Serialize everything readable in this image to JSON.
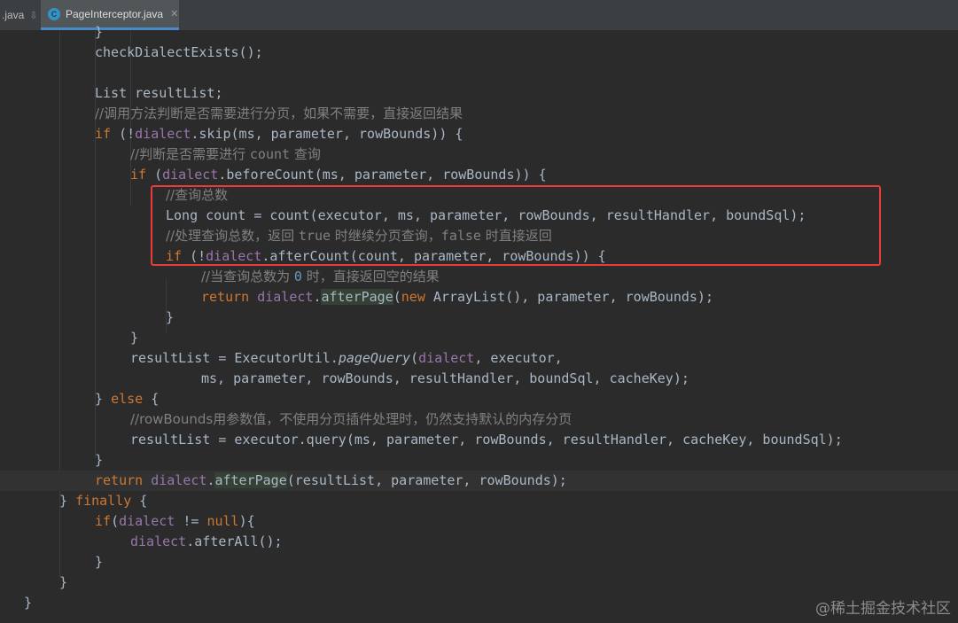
{
  "tabs": {
    "prev": {
      "label": ".java",
      "pin": "⇩"
    },
    "active": {
      "icon": "C",
      "label": "PageInterceptor.java",
      "close": "✕"
    }
  },
  "watermark": "@稀土掘金技术社区",
  "colors": {
    "background": "#2b2b2b",
    "keyword": "#cc7832",
    "field": "#9876aa",
    "comment": "#808080",
    "number": "#6897bb",
    "highlight_box": "#e83b3b"
  },
  "code": {
    "l1": "}",
    "l2": "checkDialectExists();",
    "l3": "List resultList;",
    "l4": "//调用方法判断是否需要进行分页，如果不需要，直接返回结果",
    "l5_if": "if",
    "l5_open": " (!",
    "l5_dialect": "dialect",
    "l5_rest": ".skip(ms, parameter, rowBounds)) {",
    "l6a": "//判断是否需要进行 ",
    "l6b": "count",
    "l6c": " 查询",
    "l7_if": "if",
    "l7_open": " (",
    "l7_dialect": "dialect",
    "l7_rest": ".beforeCount(ms, parameter, rowBounds)) {",
    "l8": "//查询总数",
    "l9": "Long count = count(executor, ms, parameter, rowBounds, resultHandler, boundSql);",
    "l10a": "//处理查询总数，返回 ",
    "l10b": "true",
    "l10c": " 时继续分页查询，",
    "l10d": "false",
    "l10e": " 时直接返回",
    "l11_if": "if",
    "l11_open": " (!",
    "l11_dialect": "dialect",
    "l11_rest": ".afterCount(count, parameter, rowBounds)) {",
    "l12a": "//当查询总数为 ",
    "l12b": "0",
    "l12c": " 时，直接返回空的结果",
    "l13_return": "return",
    "l13_sp": " ",
    "l13_dialect": "dialect",
    "l13_dot": ".",
    "l13_method": "afterPage",
    "l13_paren": "(",
    "l13_new": "new",
    "l13_rest": " ArrayList(), parameter, rowBounds);",
    "l14": "}",
    "l15": "}",
    "l16a": "resultList = ExecutorUtil.",
    "l16b": "pageQuery",
    "l16c": "(",
    "l16d": "dialect",
    "l16e": ", executor,",
    "l17": "ms, parameter, rowBounds, resultHandler, boundSql, cacheKey);",
    "l18_brace": "} ",
    "l18_else": "else",
    "l18_rest": " {",
    "l19": "//rowBounds用参数值，不使用分页插件处理时，仍然支持默认的内存分页",
    "l20": "resultList = executor.query(ms, parameter, rowBounds, resultHandler, cacheKey, boundSql);",
    "l21": "}",
    "l22_return": "return",
    "l22_sp": " ",
    "l22_dialect": "dialect",
    "l22_dot": ".",
    "l22_method": "afterPage",
    "l22_rest": "(resultList, parameter, rowBounds);",
    "l23_brace": "} ",
    "l23_finally": "finally",
    "l23_rest": " {",
    "l24_if": "if",
    "l24_open": "(",
    "l24_dialect": "dialect",
    "l24_neq": " != ",
    "l24_null": "null",
    "l24_rest": "){",
    "l25_dialect": "dialect",
    "l25_rest": ".afterAll();",
    "l26": "}",
    "l27": "}",
    "l28": "}"
  }
}
